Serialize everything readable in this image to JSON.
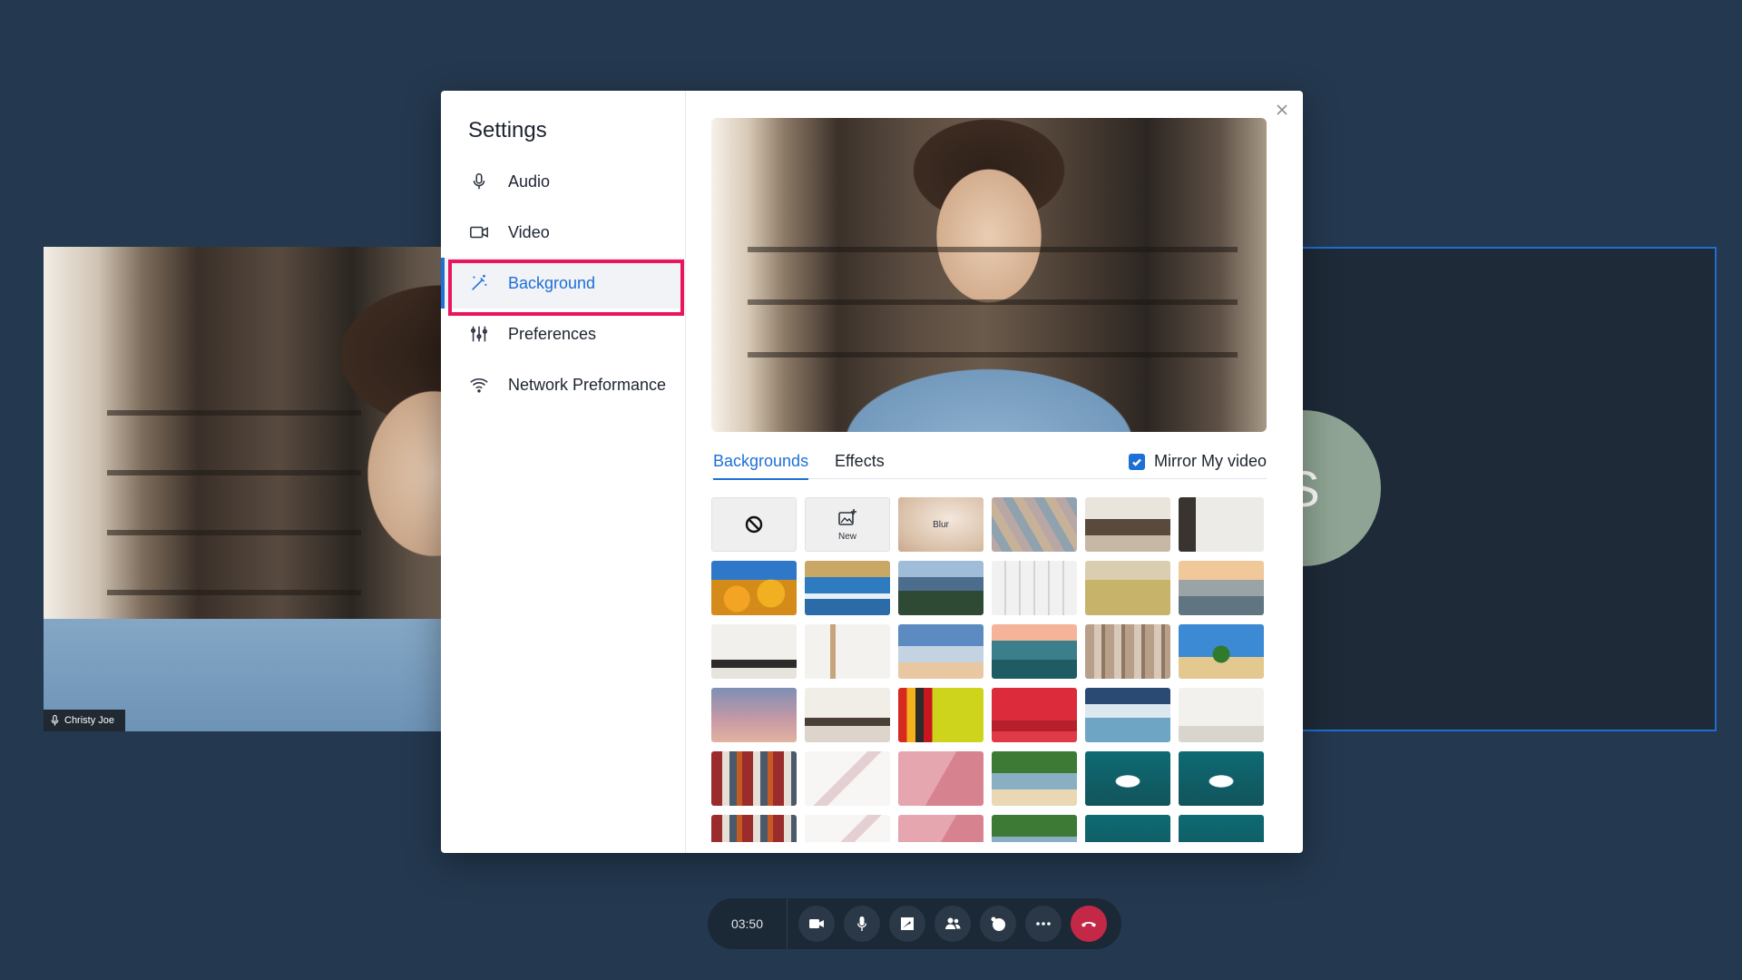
{
  "meeting": {
    "participant_name": "Christy Joe",
    "avatar_initial": "S",
    "timer": "03:50"
  },
  "settings": {
    "title": "Settings",
    "nav": [
      {
        "label": "Audio",
        "icon": "microphone-icon"
      },
      {
        "label": "Video",
        "icon": "video-camera-icon"
      },
      {
        "label": "Background",
        "icon": "magic-wand-icon",
        "active": true
      },
      {
        "label": "Preferences",
        "icon": "sliders-icon"
      },
      {
        "label": "Network Preformance",
        "icon": "wifi-icon"
      }
    ],
    "tabs": [
      {
        "label": "Backgrounds",
        "active": true
      },
      {
        "label": "Effects",
        "active": false
      }
    ],
    "mirror_label": "Mirror My video",
    "mirror_checked": true,
    "backgrounds": {
      "none_icon": "no-background-icon",
      "new_label": "New",
      "blur_label": "Blur"
    }
  },
  "colors": {
    "accent": "#1e6fd6",
    "highlight": "#e8175d",
    "end_call": "#c42847",
    "page_bg": "#24384f"
  },
  "toolbar": {
    "icons": [
      "camera-icon",
      "microphone-icon",
      "share-screen-icon",
      "participants-icon",
      "reactions-icon",
      "more-icon",
      "end-call-icon"
    ]
  }
}
